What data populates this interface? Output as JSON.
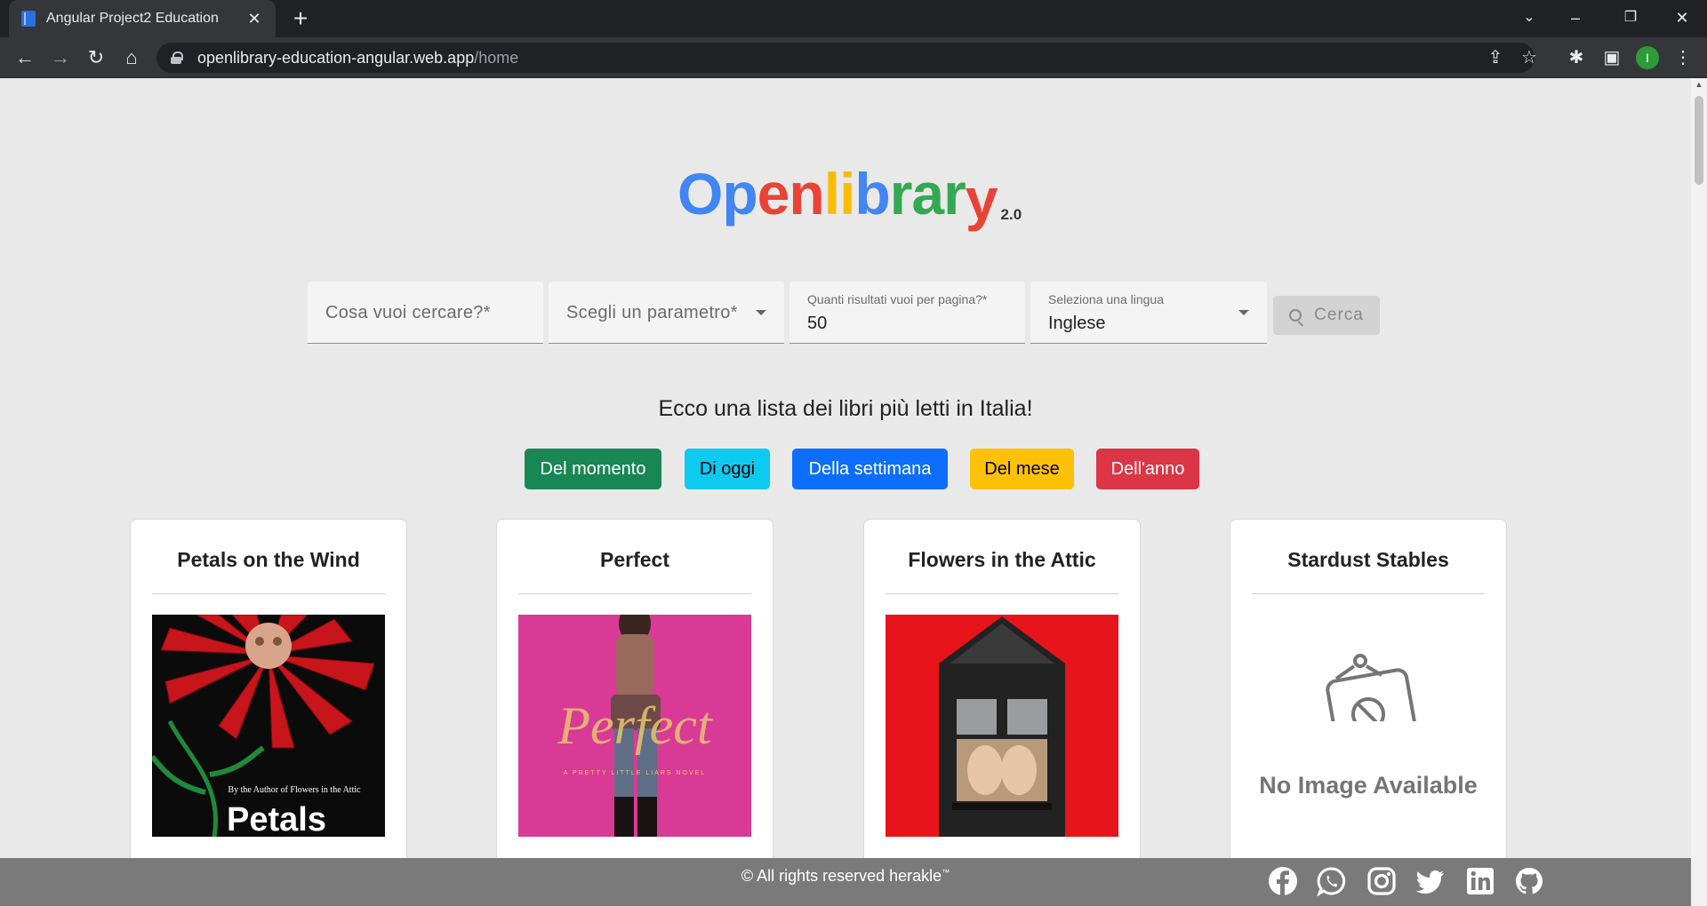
{
  "browser": {
    "tab_title": "Angular Project2 Education",
    "url_host": "openlibrary-education-angular.web.app",
    "url_path": "/home",
    "profile_initial": "I"
  },
  "logo": {
    "letters": [
      {
        "char": "O",
        "color": "#4285f4"
      },
      {
        "char": "p",
        "color": "#4285f4"
      },
      {
        "char": "e",
        "color": "#ea4335"
      },
      {
        "char": "n",
        "color": "#ea4335"
      },
      {
        "char": "l",
        "color": "#fbbc05"
      },
      {
        "char": "i",
        "color": "#fbbc05"
      },
      {
        "char": "b",
        "color": "#4285f4"
      },
      {
        "char": "r",
        "color": "#34a853"
      },
      {
        "char": "a",
        "color": "#34a853"
      },
      {
        "char": "r",
        "color": "#34a853"
      },
      {
        "char": "y",
        "color": "#ea4335"
      }
    ],
    "version": "2.0"
  },
  "search": {
    "query_placeholder": "Cosa vuoi cercare?*",
    "parameter_placeholder": "Scegli un parametro*",
    "results_label": "Quanti risultati vuoi per pagina?*",
    "results_value": "50",
    "language_label": "Seleziona una lingua",
    "language_value": "Inglese",
    "button_label": "Cerca"
  },
  "headline": "Ecco una lista dei libri più letti in Italia!",
  "filters": [
    {
      "label": "Del momento",
      "bg": "#198754",
      "fg": "#ffffff"
    },
    {
      "label": "Di oggi",
      "bg": "#0dcaf0",
      "fg": "#000000"
    },
    {
      "label": "Della settimana",
      "bg": "#0d6efd",
      "fg": "#ffffff"
    },
    {
      "label": "Del mese",
      "bg": "#ffc107",
      "fg": "#000000"
    },
    {
      "label": "Dell'anno",
      "bg": "#dc3545",
      "fg": "#ffffff"
    }
  ],
  "books": [
    {
      "title": "Petals on the Wind",
      "cover_text_small": "By the Author of Flowers in the Attic",
      "cover_text_big": "Petals"
    },
    {
      "title": "Perfect",
      "cover_text_big": "Perfect",
      "cover_text_small": "A PRETTY LITTLE LIARS NOVEL"
    },
    {
      "title": "Flowers in the Attic"
    },
    {
      "title": "Stardust Stables",
      "no_image_text": "No Image Available"
    }
  ],
  "footer": {
    "text": "© All rights reserved herakle",
    "tm": "™",
    "social": [
      "facebook-icon",
      "whatsapp-icon",
      "instagram-icon",
      "twitter-icon",
      "linkedin-icon",
      "github-icon"
    ]
  }
}
